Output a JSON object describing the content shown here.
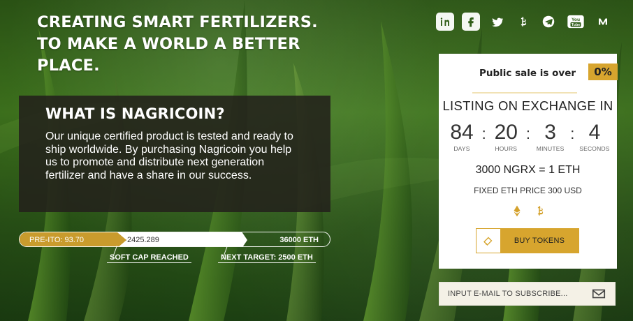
{
  "headline": {
    "line1": "CREATING SMART FERTILIZERS.",
    "line2": "TO MAKE A WORLD A BETTER",
    "line3": "PLACE."
  },
  "info": {
    "title": "WHAT IS NAGRICOIN?",
    "body": "Our unique certified product is tested and ready to ship worldwide. By purchasing Nagricoin you help us to promote and distribute next generation fertilizer and have a share in our success."
  },
  "progress": {
    "pre_ito": "PRE-ITO: 93.70",
    "mid": "2425.289",
    "end": "36000 ETH",
    "soft_cap": "SOFT CAP REACHED",
    "next_target": "NEXT TARGET: 2500 ETH"
  },
  "socials": {
    "icons": [
      "linkedin-icon",
      "facebook-icon",
      "twitter-icon",
      "bitcoin-icon",
      "telegram-icon",
      "youtube-icon",
      "medium-icon"
    ],
    "youtube_text": "You Tube"
  },
  "sale": {
    "status": "Public sale is over",
    "percent": "0%",
    "listing": "LISTING ON EXCHANGE IN",
    "countdown": {
      "days": "84",
      "days_label": "DAYS",
      "hours": "20",
      "hours_label": "HOURS",
      "minutes": "3",
      "minutes_label": "MINUTES",
      "seconds": "4",
      "seconds_label": "SECONDS"
    },
    "rate": "3000 NGRX = 1 ETH",
    "fixed": "FIXED ETH PRICE 300 USD",
    "coins": [
      "ethereum-icon",
      "bitcoin-icon"
    ],
    "buy_label": "BUY TOKENS"
  },
  "subscribe": {
    "placeholder": "INPUT E-MAIL TO SUBSCRIBE..."
  },
  "colors": {
    "gold": "#d7a52e",
    "gold_dark": "#c99b2d",
    "card_bg": "#ffffff",
    "panel_bg": "#23211b",
    "subscribe_bg": "#f4f1e6"
  }
}
